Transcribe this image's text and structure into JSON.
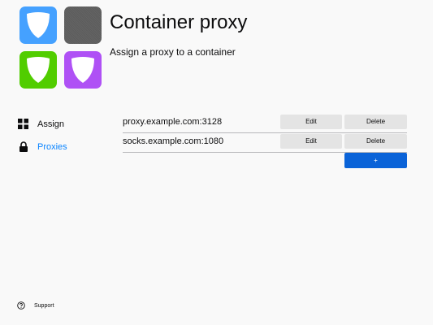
{
  "header": {
    "title": "Container proxy",
    "subtitle": "Assign a proxy to a container"
  },
  "logo": {
    "tiles": [
      {
        "icon": "shield-icon",
        "color": "#45a1ff"
      },
      {
        "icon": "checker-pattern-icon",
        "color": "#5c5c5c"
      },
      {
        "icon": "shield-icon",
        "color": "#51cd00"
      },
      {
        "icon": "shield-icon",
        "color": "#af51f5"
      }
    ]
  },
  "sidebar": {
    "items": [
      {
        "label": "Assign",
        "icon": "grid-icon",
        "active": false
      },
      {
        "label": "Proxies",
        "icon": "lock-icon",
        "active": true
      }
    ]
  },
  "proxies": [
    {
      "url": "proxy.example.com:3128",
      "edit_label": "Edit",
      "delete_label": "Delete"
    },
    {
      "url": "socks.example.com:1080",
      "edit_label": "Edit",
      "delete_label": "Delete"
    }
  ],
  "add_button": {
    "label": "+"
  },
  "footer": {
    "support_label": "Support",
    "icon": "help-circle-icon"
  },
  "colors": {
    "accent": "#0a84ff",
    "primary_button": "#0a63d8",
    "background": "#f9f9f9"
  }
}
